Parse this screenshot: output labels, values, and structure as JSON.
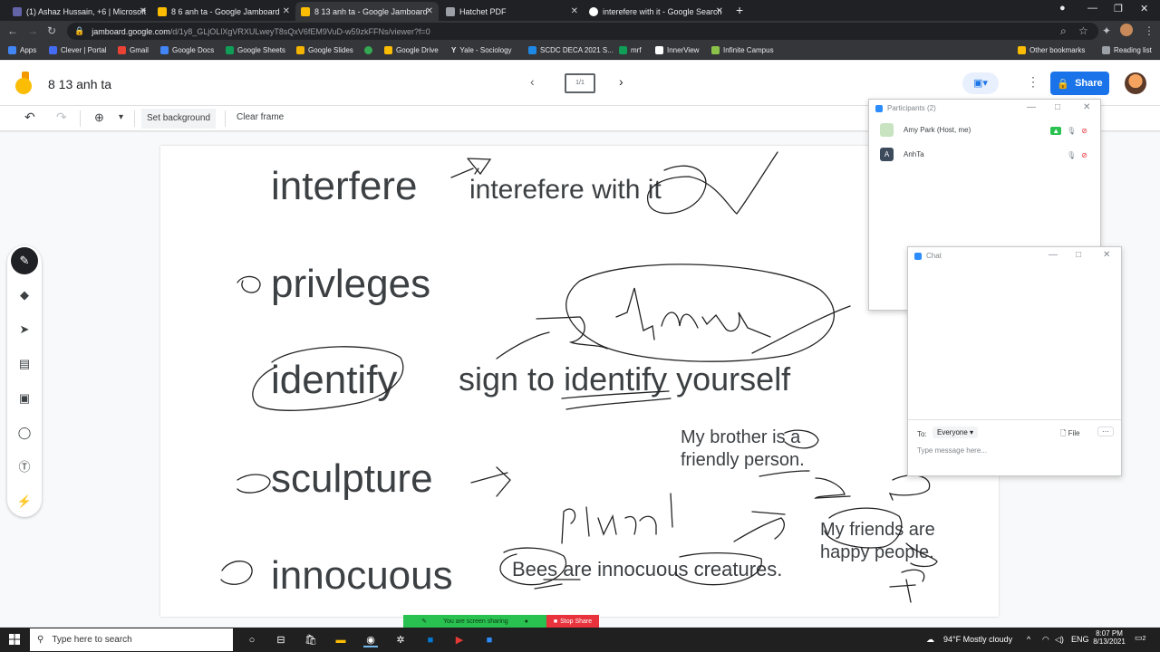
{
  "browser": {
    "tabs": [
      {
        "label": "(1) Ashaz Hussain, +6 | Microsoft",
        "active": false
      },
      {
        "label": "8 6 anh ta - Google Jamboard",
        "active": false
      },
      {
        "label": "8 13 anh ta - Google Jamboard",
        "active": true
      },
      {
        "label": "Hatchet PDF",
        "active": false
      },
      {
        "label": "interefere with it - Google Search",
        "active": false
      }
    ],
    "address_host": "jamboard.google.com",
    "address_path": "/d/1y8_GLjOLlXgVRXULweyT8sQxV6fEM9VuD-w59zkFFNs/viewer?f=0",
    "bookmarks": [
      "Apps",
      "Clever | Portal",
      "Gmail",
      "Google Docs",
      "Google Sheets",
      "Google Slides",
      "",
      "Google Drive",
      "Yale - Sociology",
      "SCDC DECA 2021 S...",
      "mrf",
      "InnerView",
      "Infinite Campus"
    ],
    "bookmarks_right": [
      "Other bookmarks",
      "Reading list"
    ]
  },
  "jamboard": {
    "title": "8 13 anh ta",
    "frame_indicator": "1/1",
    "share_label": "Share",
    "toolbar": {
      "set_background": "Set background",
      "clear_frame": "Clear frame"
    },
    "words": [
      "interfere",
      "privleges",
      "identify",
      "sculpture",
      "innocuous"
    ],
    "phrases": {
      "p1": "interefere with it",
      "p2": "sign to identify yourself",
      "p3a": "My brother is a",
      "p3b": "friendly person.",
      "p4a": "My friends are",
      "p4b": "happy people.",
      "p5": "Bees are innocuous creatures."
    }
  },
  "zoom": {
    "participants_title": "Participants (2)",
    "participants": [
      {
        "name": "Amy Park (Host, me)",
        "initial": ""
      },
      {
        "name": "AnhTa",
        "initial": "A"
      }
    ],
    "chat_title": "Chat",
    "chat_to_label": "To:",
    "chat_to_value": "Everyone",
    "chat_file": "File",
    "chat_placeholder": "Type message here...",
    "sharing_text": "You are screen sharing",
    "stop_share": "Stop Share"
  },
  "taskbar": {
    "search_placeholder": "Type here to search",
    "weather": "94°F  Mostly cloudy",
    "lang": "ENG",
    "time": "8:07 PM",
    "date": "8/13/2021",
    "notif_count": "2"
  },
  "colors": {
    "accent": "#1a73e8",
    "jam_yellow": "#fbbc04",
    "zoom_blue": "#2d8cff",
    "share_green": "#29c150",
    "stop_red": "#e8323c"
  }
}
